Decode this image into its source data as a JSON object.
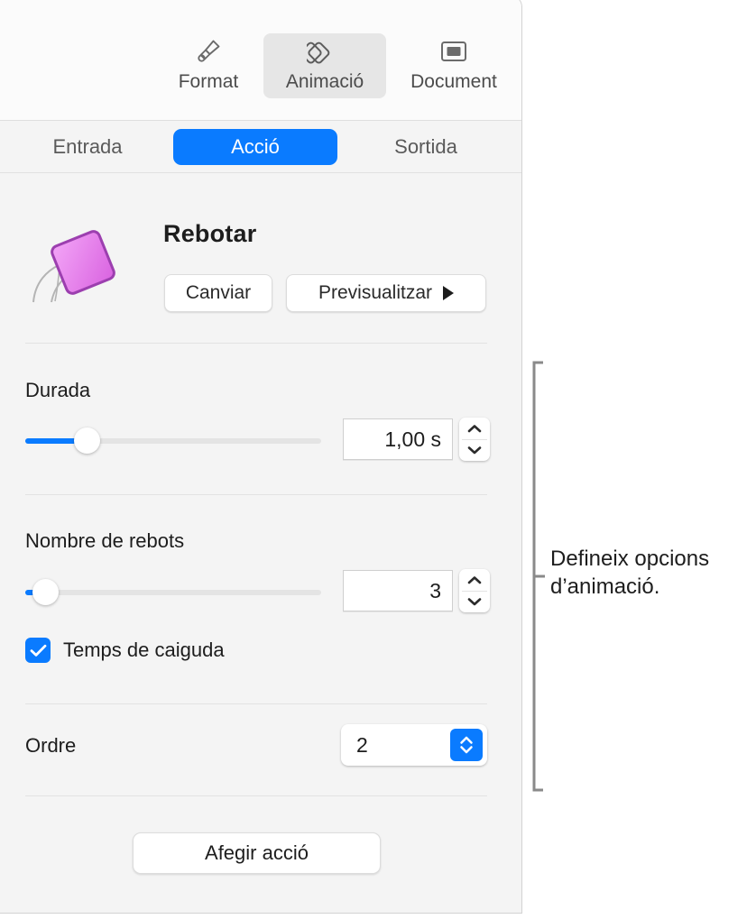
{
  "panel": {
    "toolbar": {
      "items": [
        {
          "label": "Format",
          "icon": "paintbrush-icon",
          "selected": false
        },
        {
          "label": "Animació",
          "icon": "animation-diamonds-icon",
          "selected": true
        },
        {
          "label": "Document",
          "icon": "document-rect-icon",
          "selected": false
        }
      ]
    },
    "segments": {
      "tabs": [
        {
          "label": "Entrada",
          "selected": false
        },
        {
          "label": "Acció",
          "selected": true
        },
        {
          "label": "Sortida",
          "selected": false
        }
      ]
    },
    "effect": {
      "thumbnail_icon": "bouncing-square-icon",
      "name": "Rebotar",
      "change_button": "Canviar",
      "preview_button": "Previsualitzar",
      "preview_icon": "play-triangle-icon"
    },
    "duration": {
      "label": "Durada",
      "value": "1,00 s",
      "slider_percent": 20,
      "stepper_up_icon": "chevron-up-icon",
      "stepper_down_icon": "chevron-down-icon"
    },
    "bounces": {
      "label": "Nombre de rebots",
      "value": "3",
      "slider_percent": 3,
      "stepper_up_icon": "chevron-up-icon",
      "stepper_down_icon": "chevron-down-icon"
    },
    "fall_time": {
      "label": "Temps de caiguda",
      "checked": true,
      "check_icon": "checkmark-icon"
    },
    "order": {
      "label": "Ordre",
      "value": "2",
      "arrows_icon": "chevron-up-down-icon"
    },
    "add_action_button": "Afegir acció"
  },
  "callout": {
    "text": "Defineix opcions d’animació.",
    "bracket_icon": "callout-bracket-icon"
  },
  "colors": {
    "accent_blue": "#0a7bff",
    "panel_bg": "#f4f4f4",
    "toolbar_bg": "#fbfbfb",
    "shape_pink": "#e87ceb",
    "shape_border": "#8e3aa0"
  }
}
